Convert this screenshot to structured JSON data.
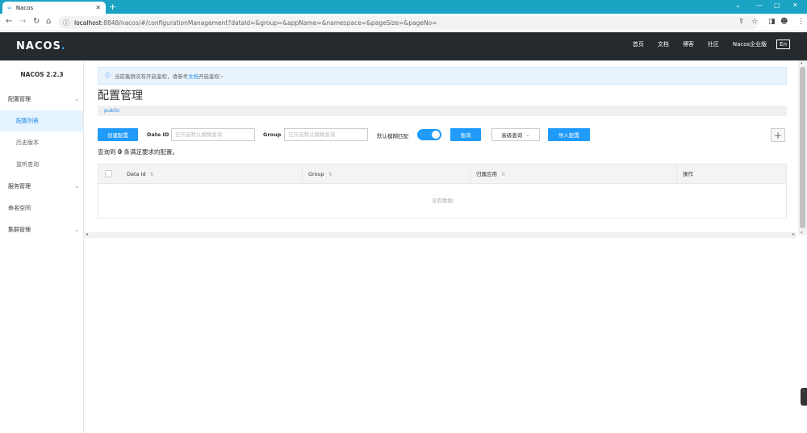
{
  "browser": {
    "tab_title": "Nacos",
    "url_host": "localhost",
    "url_path": ":8848/nacos/#/configurationManagement?dataId=&group=&appName=&namespace=&pageSize=&pageNo="
  },
  "header": {
    "logo_text": "NACOS",
    "logo_dot": ".",
    "nav": [
      "首页",
      "文档",
      "博客",
      "社区",
      "Nacos企业版"
    ],
    "lang": "En"
  },
  "sidebar": {
    "version": "NACOS 2.2.3",
    "items": [
      {
        "label": "配置管理",
        "type": "group"
      },
      {
        "label": "配置列表",
        "type": "sub"
      },
      {
        "label": "历史版本",
        "type": "sub"
      },
      {
        "label": "监听查询",
        "type": "sub"
      },
      {
        "label": "服务管理",
        "type": "group"
      },
      {
        "label": "命名空间",
        "type": "group"
      },
      {
        "label": "集群管理",
        "type": "group"
      }
    ]
  },
  "main": {
    "notice_prefix": "当前集群没有开启鉴权，请参考",
    "notice_link": "文档",
    "notice_suffix": "开启鉴权~",
    "title": "配置管理",
    "namespace": "public",
    "toolbar": {
      "create_btn": "创建配置",
      "dataid_label": "Date ID",
      "dataid_placeholder": "已开启默认模糊查询",
      "group_label": "Group",
      "group_placeholder": "已开启默认模糊查询",
      "fuzzy_label": "默认模糊匹配",
      "fuzzy_on": true,
      "search_btn": "查询",
      "advanced_btn": "高级查询",
      "import_btn": "导入配置",
      "plus": "+"
    },
    "result_prefix": "查询到",
    "result_count": "0",
    "result_suffix": "条满足要求的配置。",
    "table": {
      "columns": [
        "Data Id",
        "Group",
        "归属应用",
        "操作"
      ],
      "empty": "没有数据"
    }
  },
  "colors": {
    "tabbar": "#1aa3c2",
    "header": "#252a2f",
    "primary": "#209bfa",
    "active_bg": "#e5f3ff"
  }
}
